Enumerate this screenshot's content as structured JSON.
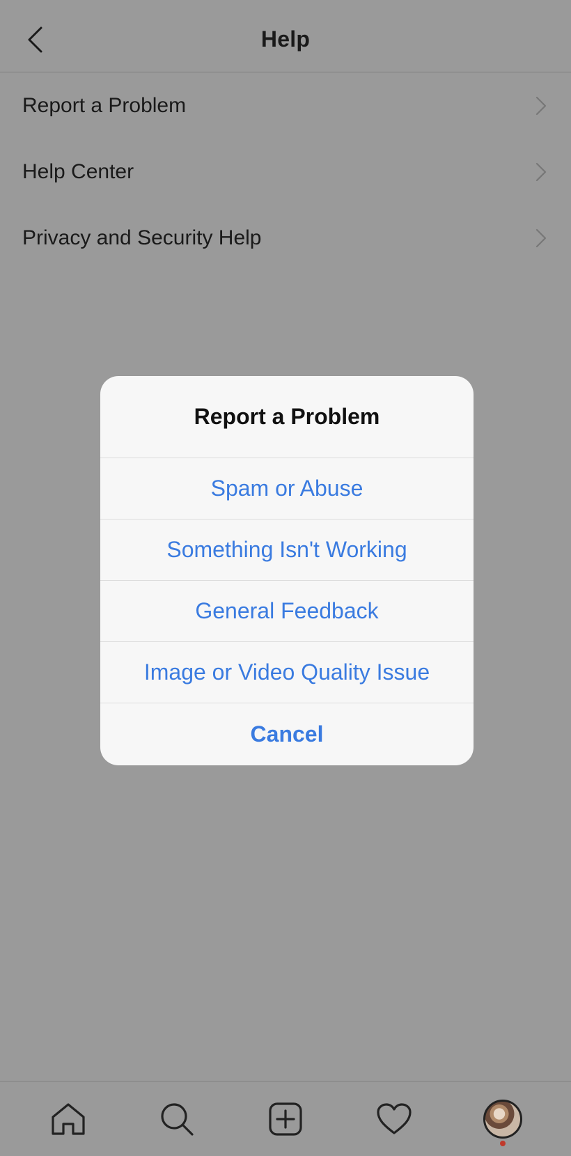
{
  "header": {
    "title": "Help",
    "back_icon": "chevron-left-icon"
  },
  "menu": {
    "items": [
      {
        "label": "Report a Problem",
        "icon": "chevron-right-icon"
      },
      {
        "label": "Help Center",
        "icon": "chevron-right-icon"
      },
      {
        "label": "Privacy and Security Help",
        "icon": "chevron-right-icon"
      }
    ]
  },
  "alert": {
    "title": "Report a Problem",
    "options": [
      "Spam or Abuse",
      "Something Isn't Working",
      "General Feedback",
      "Image or Video Quality Issue"
    ],
    "cancel_label": "Cancel"
  },
  "tabbar": {
    "items": [
      "home-icon",
      "search-icon",
      "add-post-icon",
      "heart-icon",
      "profile-avatar"
    ]
  },
  "colors": {
    "overlay_bg": "#9a9a9a",
    "accent": "#3a7be0",
    "alert_bg": "#f7f7f7",
    "notification_dot": "#c0392b"
  }
}
